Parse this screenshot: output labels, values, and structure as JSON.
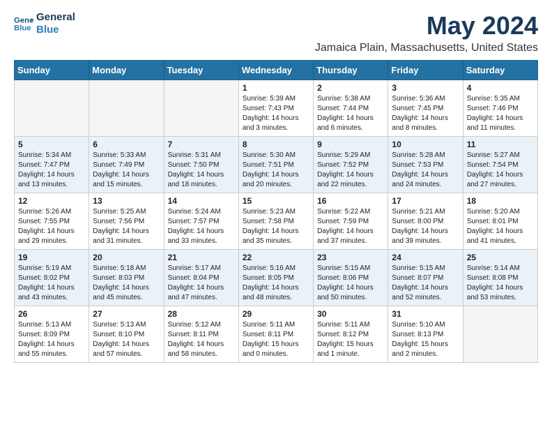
{
  "logo": {
    "line1": "General",
    "line2": "Blue"
  },
  "title": "May 2024",
  "subtitle": "Jamaica Plain, Massachusetts, United States",
  "days_of_week": [
    "Sunday",
    "Monday",
    "Tuesday",
    "Wednesday",
    "Thursday",
    "Friday",
    "Saturday"
  ],
  "weeks": [
    [
      {
        "day": null
      },
      {
        "day": null
      },
      {
        "day": null
      },
      {
        "day": "1",
        "sunrise": "5:39 AM",
        "sunset": "7:43 PM",
        "daylight": "14 hours and 3 minutes."
      },
      {
        "day": "2",
        "sunrise": "5:38 AM",
        "sunset": "7:44 PM",
        "daylight": "14 hours and 6 minutes."
      },
      {
        "day": "3",
        "sunrise": "5:36 AM",
        "sunset": "7:45 PM",
        "daylight": "14 hours and 8 minutes."
      },
      {
        "day": "4",
        "sunrise": "5:35 AM",
        "sunset": "7:46 PM",
        "daylight": "14 hours and 11 minutes."
      }
    ],
    [
      {
        "day": "5",
        "sunrise": "5:34 AM",
        "sunset": "7:47 PM",
        "daylight": "14 hours and 13 minutes."
      },
      {
        "day": "6",
        "sunrise": "5:33 AM",
        "sunset": "7:49 PM",
        "daylight": "14 hours and 15 minutes."
      },
      {
        "day": "7",
        "sunrise": "5:31 AM",
        "sunset": "7:50 PM",
        "daylight": "14 hours and 18 minutes."
      },
      {
        "day": "8",
        "sunrise": "5:30 AM",
        "sunset": "7:51 PM",
        "daylight": "14 hours and 20 minutes."
      },
      {
        "day": "9",
        "sunrise": "5:29 AM",
        "sunset": "7:52 PM",
        "daylight": "14 hours and 22 minutes."
      },
      {
        "day": "10",
        "sunrise": "5:28 AM",
        "sunset": "7:53 PM",
        "daylight": "14 hours and 24 minutes."
      },
      {
        "day": "11",
        "sunrise": "5:27 AM",
        "sunset": "7:54 PM",
        "daylight": "14 hours and 27 minutes."
      }
    ],
    [
      {
        "day": "12",
        "sunrise": "5:26 AM",
        "sunset": "7:55 PM",
        "daylight": "14 hours and 29 minutes."
      },
      {
        "day": "13",
        "sunrise": "5:25 AM",
        "sunset": "7:56 PM",
        "daylight": "14 hours and 31 minutes."
      },
      {
        "day": "14",
        "sunrise": "5:24 AM",
        "sunset": "7:57 PM",
        "daylight": "14 hours and 33 minutes."
      },
      {
        "day": "15",
        "sunrise": "5:23 AM",
        "sunset": "7:58 PM",
        "daylight": "14 hours and 35 minutes."
      },
      {
        "day": "16",
        "sunrise": "5:22 AM",
        "sunset": "7:59 PM",
        "daylight": "14 hours and 37 minutes."
      },
      {
        "day": "17",
        "sunrise": "5:21 AM",
        "sunset": "8:00 PM",
        "daylight": "14 hours and 39 minutes."
      },
      {
        "day": "18",
        "sunrise": "5:20 AM",
        "sunset": "8:01 PM",
        "daylight": "14 hours and 41 minutes."
      }
    ],
    [
      {
        "day": "19",
        "sunrise": "5:19 AM",
        "sunset": "8:02 PM",
        "daylight": "14 hours and 43 minutes."
      },
      {
        "day": "20",
        "sunrise": "5:18 AM",
        "sunset": "8:03 PM",
        "daylight": "14 hours and 45 minutes."
      },
      {
        "day": "21",
        "sunrise": "5:17 AM",
        "sunset": "8:04 PM",
        "daylight": "14 hours and 47 minutes."
      },
      {
        "day": "22",
        "sunrise": "5:16 AM",
        "sunset": "8:05 PM",
        "daylight": "14 hours and 48 minutes."
      },
      {
        "day": "23",
        "sunrise": "5:15 AM",
        "sunset": "8:06 PM",
        "daylight": "14 hours and 50 minutes."
      },
      {
        "day": "24",
        "sunrise": "5:15 AM",
        "sunset": "8:07 PM",
        "daylight": "14 hours and 52 minutes."
      },
      {
        "day": "25",
        "sunrise": "5:14 AM",
        "sunset": "8:08 PM",
        "daylight": "14 hours and 53 minutes."
      }
    ],
    [
      {
        "day": "26",
        "sunrise": "5:13 AM",
        "sunset": "8:09 PM",
        "daylight": "14 hours and 55 minutes."
      },
      {
        "day": "27",
        "sunrise": "5:13 AM",
        "sunset": "8:10 PM",
        "daylight": "14 hours and 57 minutes."
      },
      {
        "day": "28",
        "sunrise": "5:12 AM",
        "sunset": "8:11 PM",
        "daylight": "14 hours and 58 minutes."
      },
      {
        "day": "29",
        "sunrise": "5:11 AM",
        "sunset": "8:11 PM",
        "daylight": "15 hours and 0 minutes."
      },
      {
        "day": "30",
        "sunrise": "5:11 AM",
        "sunset": "8:12 PM",
        "daylight": "15 hours and 1 minute."
      },
      {
        "day": "31",
        "sunrise": "5:10 AM",
        "sunset": "8:13 PM",
        "daylight": "15 hours and 2 minutes."
      },
      {
        "day": null
      }
    ]
  ],
  "labels": {
    "sunrise": "Sunrise:",
    "sunset": "Sunset:",
    "daylight": "Daylight hours"
  }
}
